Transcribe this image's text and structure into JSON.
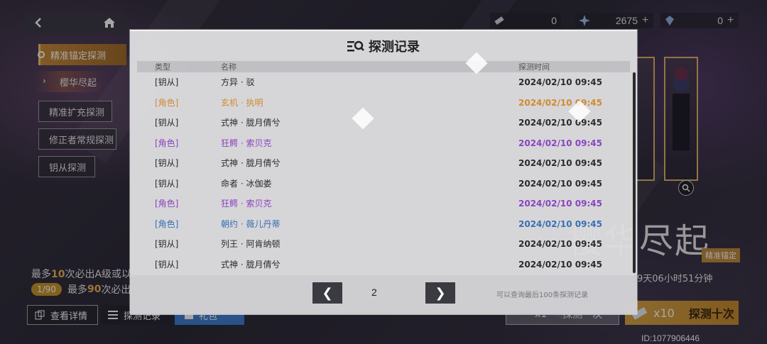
{
  "nav": {
    "back_icon": "back-arrow-icon",
    "home_icon": "home-icon"
  },
  "currency": [
    {
      "icon": "ticket-icon",
      "value": "0",
      "plus": ""
    },
    {
      "icon": "crystal-icon",
      "value": "2675",
      "plus": "+"
    },
    {
      "icon": "gem-icon",
      "value": "0",
      "plus": "+"
    }
  ],
  "left_menu": {
    "active": "精准锚定探测",
    "sub": "樱华尽起",
    "items": [
      "精准扩充探测",
      "修正者常规探测",
      "钥从探测"
    ]
  },
  "info": {
    "line1_prefix": "最多",
    "line1_num": "10",
    "line1_suffix": "次必出A级或以上",
    "counter": "1/90",
    "line2_prefix": "最多",
    "line2_num": "90",
    "line2_suffix": "次必出…"
  },
  "bottom_buttons": {
    "details": "查看详情",
    "records": "探测记录",
    "pack": "礼包"
  },
  "banner": {
    "title": "樱华尽起",
    "tag": "精准锚定",
    "timer": "9天06小时51分钟",
    "pull1_count": "x1",
    "pull1_label": "探测一次",
    "pull10_count": "x10",
    "pull10_label": "探测十次",
    "user_id": "ID:1077906446"
  },
  "modal": {
    "title": "探测记录",
    "title_icon": "list-search-icon",
    "headers": {
      "type": "类型",
      "name": "名称",
      "time": "探测时间"
    },
    "rows": [
      {
        "type": "[钥从]",
        "name": "方异 · 驳",
        "time": "2024/02/10 09:45",
        "color": "gray"
      },
      {
        "type": "[角色]",
        "name": "玄机 · 执明",
        "time": "2024/02/10 09:45",
        "color": "orange"
      },
      {
        "type": "[钥从]",
        "name": "式神 · 胧月倩兮",
        "time": "2024/02/10 09:45",
        "color": "gray"
      },
      {
        "type": "[角色]",
        "name": "狂鳄 · 索贝克",
        "time": "2024/02/10 09:45",
        "color": "purple"
      },
      {
        "type": "[钥从]",
        "name": "式神 · 胧月倩兮",
        "time": "2024/02/10 09:45",
        "color": "gray"
      },
      {
        "type": "[钥从]",
        "name": "命者 · 冰伽娄",
        "time": "2024/02/10 09:45",
        "color": "gray"
      },
      {
        "type": "[角色]",
        "name": "狂鳄 · 索贝克",
        "time": "2024/02/10 09:45",
        "color": "purple"
      },
      {
        "type": "[角色]",
        "name": "朝约 · 薇儿丹蒂",
        "time": "2024/02/10 09:45",
        "color": "blue"
      },
      {
        "type": "[钥从]",
        "name": "列王 · 阿肯纳顿",
        "time": "2024/02/10 09:45",
        "color": "gray"
      },
      {
        "type": "[钥从]",
        "name": "式神 · 胧月倩兮",
        "time": "2024/02/10 09:45",
        "color": "gray"
      }
    ],
    "page": "2",
    "prev_label": "❮",
    "next_label": "❯",
    "hint": "可以查询最后100条探测记录"
  },
  "colors": {
    "orange": "#d08a2e",
    "purple": "#8b44c0",
    "blue": "#3a6fb3",
    "gray": "#2b2b2b",
    "gold": "#c8952e"
  }
}
